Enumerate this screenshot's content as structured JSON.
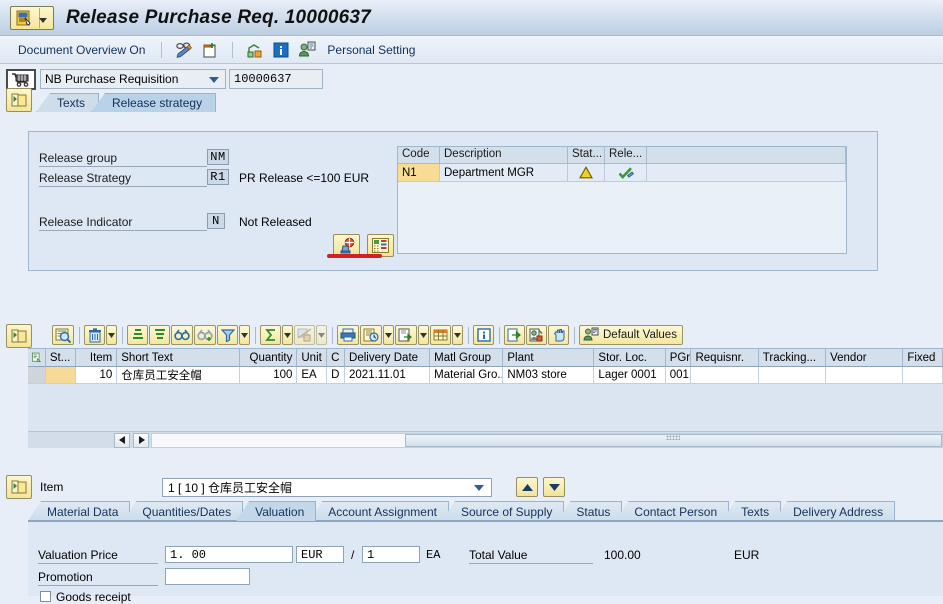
{
  "window": {
    "title": "Release Purchase Req. 10000637",
    "sys_menu_icon": "sap-document-icon"
  },
  "toolbar": {
    "document_overview": "Document Overview On",
    "icons": [
      {
        "name": "display-change-icon"
      },
      {
        "name": "other-purchase-requisition-icon"
      },
      {
        "name": "print-preview-icon"
      },
      {
        "name": "messages-icon"
      }
    ],
    "personal_setting": "Personal Setting"
  },
  "doc_type": {
    "cart_icon": "shopping-cart-icon",
    "selected": "NB Purchase Requisition",
    "number": "10000637"
  },
  "header_tabs": [
    {
      "label": "Texts",
      "selected": false
    },
    {
      "label": "Release strategy",
      "selected": true
    }
  ],
  "release": {
    "group_label": "Release group",
    "group_value": "NM",
    "strategy_label": "Release Strategy",
    "strategy_value": "R1",
    "strategy_desc": "PR Release <=100 EUR",
    "indicator_label": "Release Indicator",
    "indicator_value": "N",
    "indicator_desc": "Not Released",
    "buttons": [
      {
        "name": "release-button",
        "icon": "release-stamp-icon"
      },
      {
        "name": "release-prerequisite-button",
        "icon": "list-detail-icon"
      }
    ],
    "table": {
      "columns": [
        "Code",
        "Description",
        "Stat...",
        "Rele..."
      ],
      "rows": [
        {
          "code": "N1",
          "description": "Department MGR",
          "status_icon": "warning-triangle-icon",
          "release_icon": "green-check-pencil-icon"
        }
      ]
    }
  },
  "grid_toolbar": {
    "buttons": [
      {
        "name": "detail-button",
        "icon": "magnifier-detail-icon"
      },
      {
        "name": "delete-button",
        "icon": "trash-icon"
      },
      {
        "name": "sort-ascending-button",
        "icon": "sort-asc-icon"
      },
      {
        "name": "sort-descending-button",
        "icon": "sort-desc-icon"
      },
      {
        "name": "find-button",
        "icon": "binoculars-icon"
      },
      {
        "name": "find-next-button",
        "icon": "binoculars-plus-icon"
      },
      {
        "name": "filter-button",
        "icon": "filter-icon"
      },
      {
        "name": "total-button",
        "icon": "sigma-icon"
      },
      {
        "name": "subtotal-button",
        "icon": "subtotal-icon"
      },
      {
        "name": "print-button",
        "icon": "printer-icon"
      },
      {
        "name": "print-version-button",
        "icon": "print-version-icon"
      },
      {
        "name": "export-button",
        "icon": "export-icon"
      },
      {
        "name": "layout-button",
        "icon": "table-layout-icon"
      },
      {
        "name": "info-button",
        "icon": "info-icon"
      },
      {
        "name": "to-overview-button",
        "icon": "arrow-out-icon"
      },
      {
        "name": "personal-value-button",
        "icon": "person-key-icon"
      },
      {
        "name": "select-all-button",
        "icon": "hand-select-icon"
      }
    ],
    "default_values_label": "Default Values",
    "default_values_icon": "person-default-icon"
  },
  "item_grid": {
    "columns": [
      "",
      "St...",
      "Item",
      "Short Text",
      "Quantity",
      "Unit",
      "C",
      "Delivery Date",
      "Matl Group",
      "Plant",
      "Stor. Loc.",
      "PGr",
      "Requisnr.",
      "Tracking...",
      "Vendor",
      "Fixed"
    ],
    "rows": [
      {
        "status": "",
        "item": "10",
        "short_text": "仓库员工安全帽",
        "quantity": "100",
        "unit": "EA",
        "c": "D",
        "delivery_date": "2021.11.01",
        "matl_group": "Material Gro...",
        "plant": "NM03 store",
        "stor_loc": "Lager 0001",
        "pgr": "001",
        "requisnr": "",
        "tracking": "",
        "vendor": "",
        "fixed": ""
      }
    ]
  },
  "item_selector": {
    "icon": "item-folder-icon",
    "label": "Item",
    "value": "1 [ 10 ] 仓库员工安全帽",
    "up_button": "scroll-up-button",
    "down_button": "scroll-down-button"
  },
  "detail_tabs": [
    {
      "label": "Material Data",
      "selected": false
    },
    {
      "label": "Quantities/Dates",
      "selected": false
    },
    {
      "label": "Valuation",
      "selected": true
    },
    {
      "label": "Account Assignment",
      "selected": false
    },
    {
      "label": "Source of Supply",
      "selected": false
    },
    {
      "label": "Status",
      "selected": false
    },
    {
      "label": "Contact Person",
      "selected": false
    },
    {
      "label": "Texts",
      "selected": false
    },
    {
      "label": "Delivery Address",
      "selected": false
    }
  ],
  "valuation": {
    "price_label": "Valuation Price",
    "price_value": "1. 00",
    "currency": "EUR",
    "slash": "/",
    "per_value": "1",
    "per_unit": "EA",
    "total_label": "Total Value",
    "total_value": "100.00",
    "total_currency": "EUR",
    "promotion_label": "Promotion",
    "promotion_value": "",
    "goods_receipt_label": "Goods receipt"
  }
}
